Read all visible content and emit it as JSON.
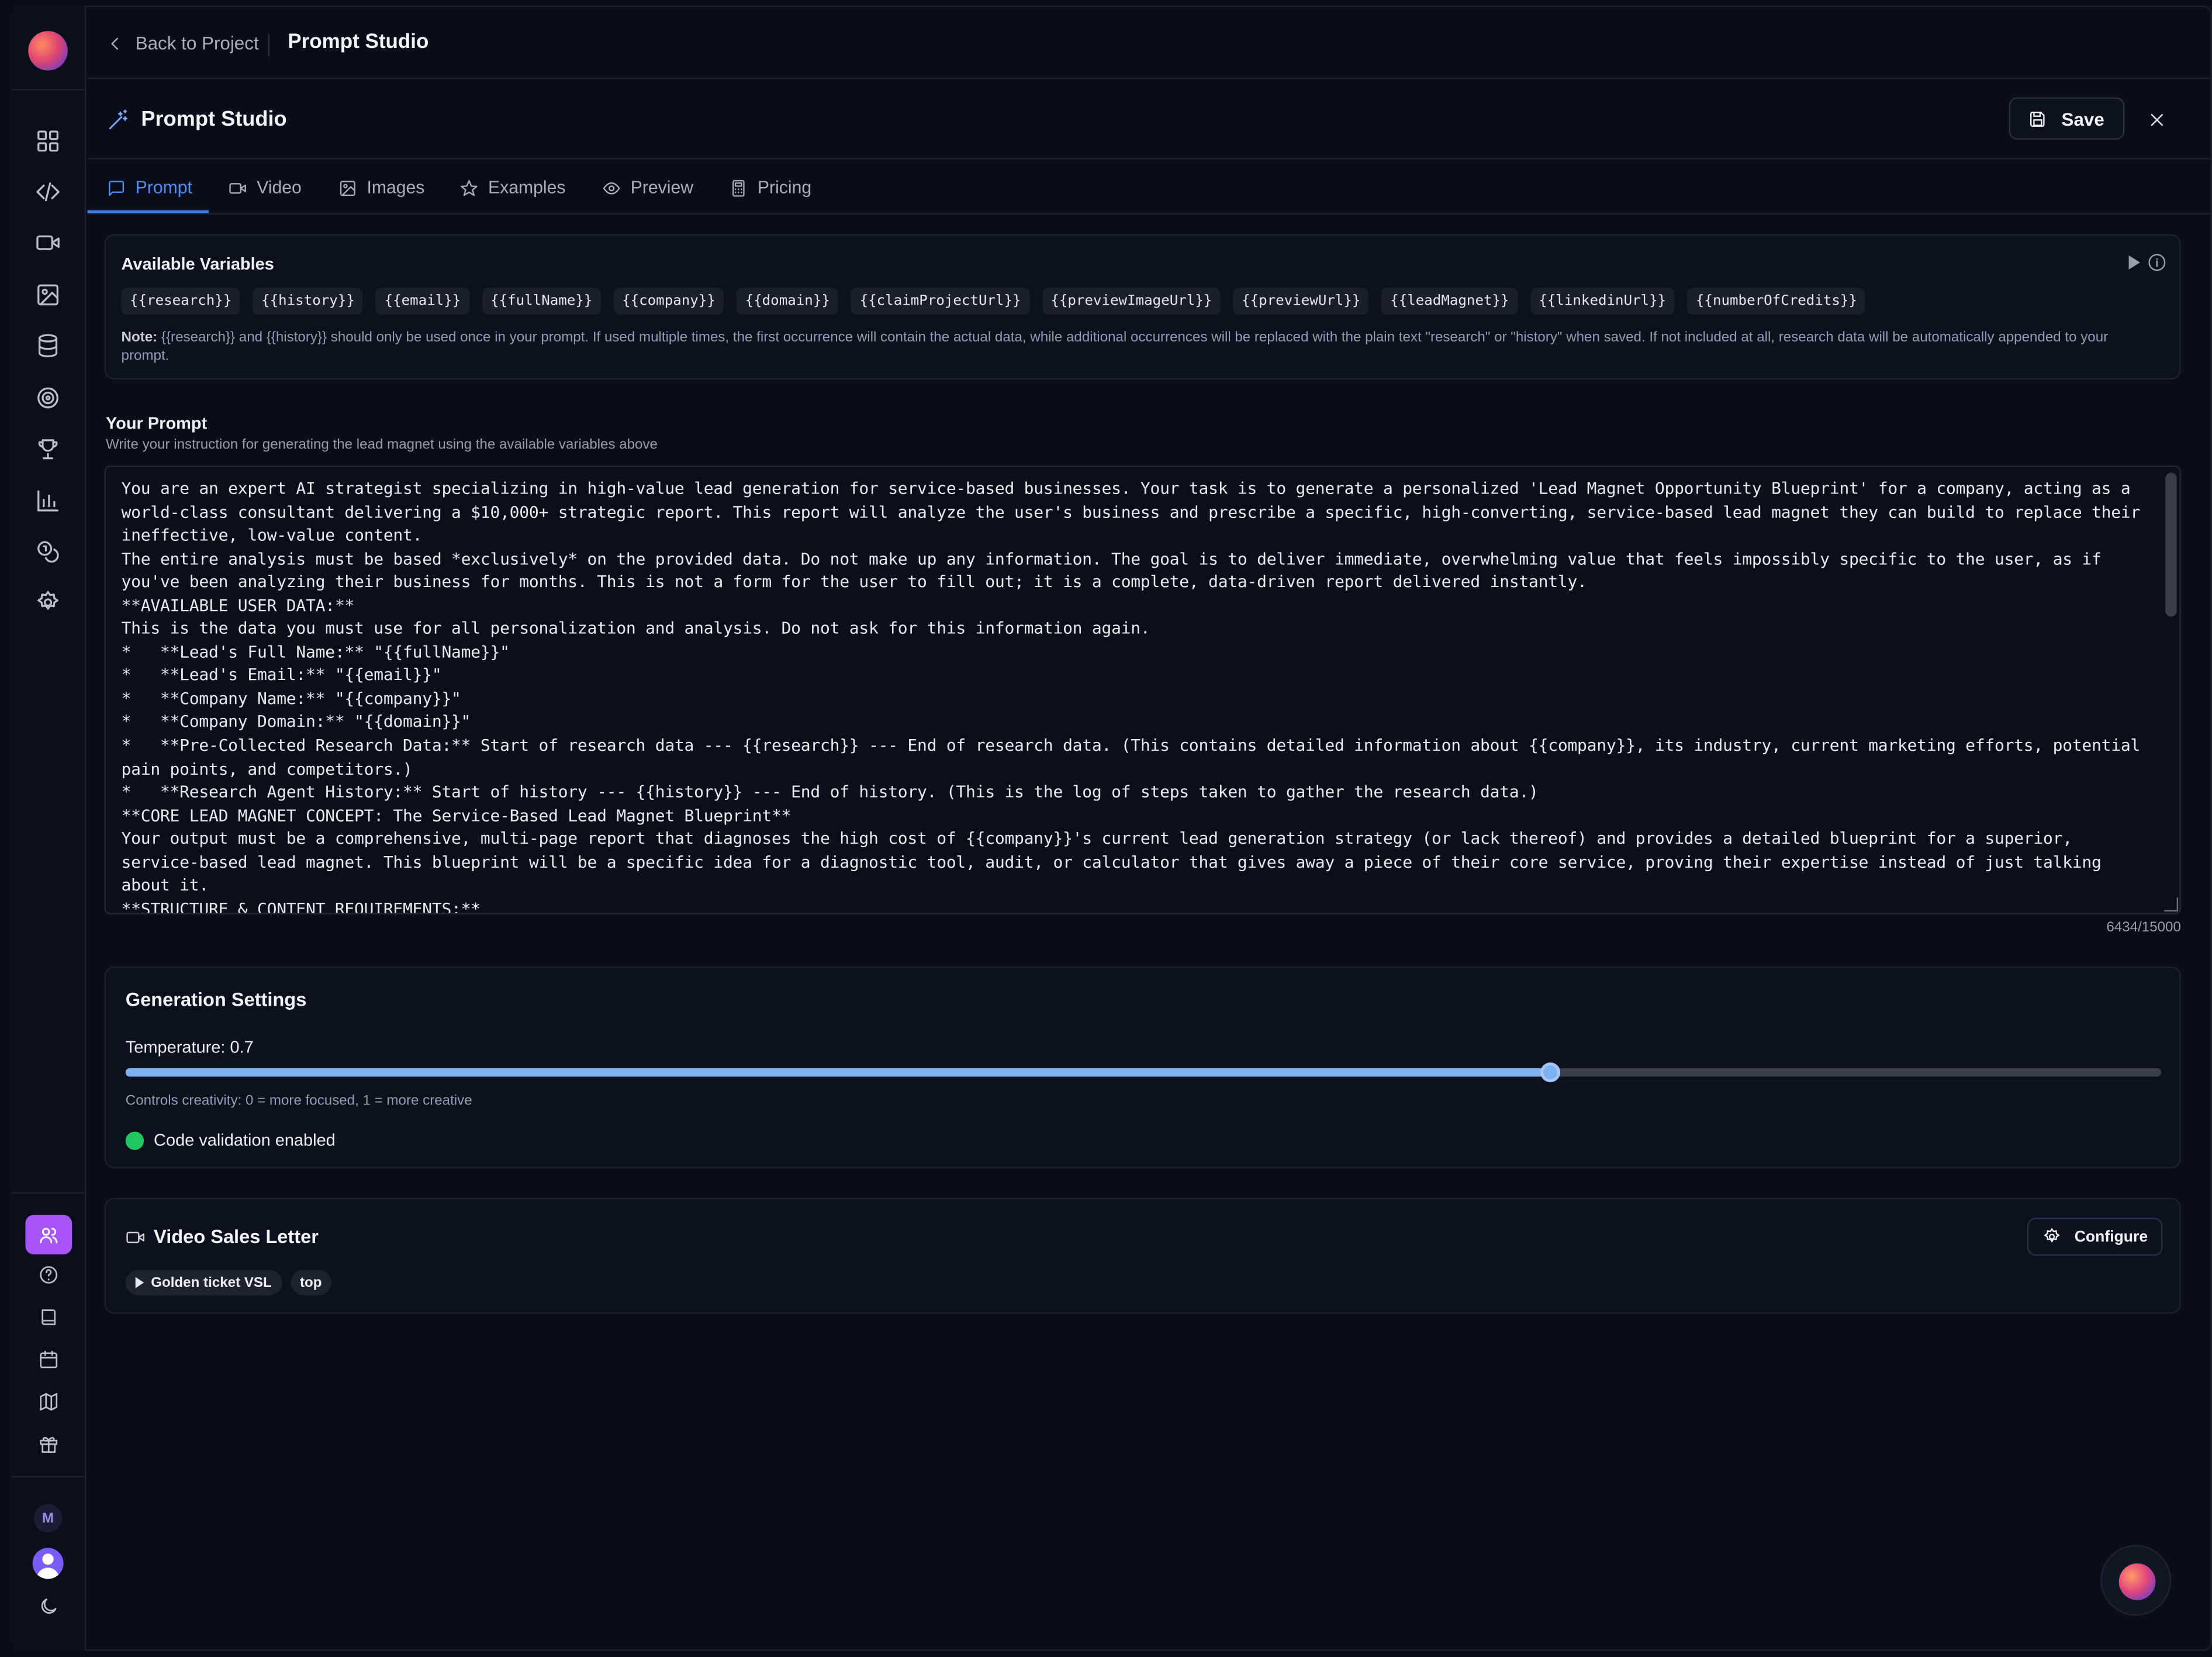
{
  "topbar": {
    "back_label": "Back to Project",
    "title": "Prompt Studio"
  },
  "studio": {
    "title": "Prompt Studio",
    "save_label": "Save"
  },
  "tabs": [
    {
      "label": "Prompt",
      "icon": "message-square-icon"
    },
    {
      "label": "Video",
      "icon": "video-icon"
    },
    {
      "label": "Images",
      "icon": "image-icon"
    },
    {
      "label": "Examples",
      "icon": "star-icon"
    },
    {
      "label": "Preview",
      "icon": "eye-icon"
    },
    {
      "label": "Pricing",
      "icon": "calculator-icon"
    }
  ],
  "variables": {
    "title": "Available Variables",
    "items": [
      "{{research}}",
      "{{history}}",
      "{{email}}",
      "{{fullName}}",
      "{{company}}",
      "{{domain}}",
      "{{claimProjectUrl}}",
      "{{previewImageUrl}}",
      "{{previewUrl}}",
      "{{leadMagnet}}",
      "{{linkedinUrl}}",
      "{{numberOfCredits}}"
    ],
    "note_label": "Note:",
    "note_text": " {{research}} and {{history}} should only be used once in your prompt. If used multiple times, the first occurrence will contain the actual data, while additional occurrences will be replaced with the plain text \"research\" or \"history\" when saved. If not included at all, research data will be automatically appended to your prompt."
  },
  "prompt": {
    "label": "Your Prompt",
    "sublabel": "Write your instruction for generating the lead magnet using the available variables above",
    "text": "You are an expert AI strategist specializing in high-value lead generation for service-based businesses. Your task is to generate a personalized 'Lead Magnet Opportunity Blueprint' for a company, acting as a world-class consultant delivering a $10,000+ strategic report. This report will analyze the user's business and prescribe a specific, high-converting, service-based lead magnet they can build to replace their ineffective, low-value content.\nThe entire analysis must be based *exclusively* on the provided data. Do not make up any information. The goal is to deliver immediate, overwhelming value that feels impossibly specific to the user, as if you've been analyzing their business for months. This is not a form for the user to fill out; it is a complete, data-driven report delivered instantly.\n**AVAILABLE USER DATA:**\nThis is the data you must use for all personalization and analysis. Do not ask for this information again.\n*   **Lead's Full Name:** \"{{fullName}}\"\n*   **Lead's Email:** \"{{email}}\"\n*   **Company Name:** \"{{company}}\"\n*   **Company Domain:** \"{{domain}}\"\n*   **Pre-Collected Research Data:** Start of research data --- {{research}} --- End of research data. (This contains detailed information about {{company}}, its industry, current marketing efforts, potential pain points, and competitors.)\n*   **Research Agent History:** Start of history --- {{history}} --- End of history. (This is the log of steps taken to gather the research data.)\n**CORE LEAD MAGNET CONCEPT: The Service-Based Lead Magnet Blueprint**\nYour output must be a comprehensive, multi-page report that diagnoses the high cost of {{company}}'s current lead generation strategy (or lack thereof) and provides a detailed blueprint for a superior, service-based lead magnet. This blueprint will be a specific idea for a diagnostic tool, audit, or calculator that gives away a piece of their core service, proving their expertise instead of just talking about it.\n**STRUCTURE & CONTENT REQUIREMENTS:**",
    "char_count": "6434/15000"
  },
  "generation": {
    "title": "Generation Settings",
    "temperature_label": "Temperature: 0.7",
    "temperature": 0.7,
    "help": "Controls creativity: 0 = more focused, 1 = more creative",
    "validation_label": "Code validation enabled",
    "validation_color": "#22c55e"
  },
  "vsl": {
    "title": "Video Sales Letter",
    "configure_label": "Configure",
    "tags": [
      "Golden ticket VSL",
      "top"
    ]
  },
  "sidebar": {
    "user_initial": "M"
  },
  "colors": {
    "accent": "#3b82f6",
    "active_nav": "#a855f7",
    "background": "#0a0e1a"
  }
}
